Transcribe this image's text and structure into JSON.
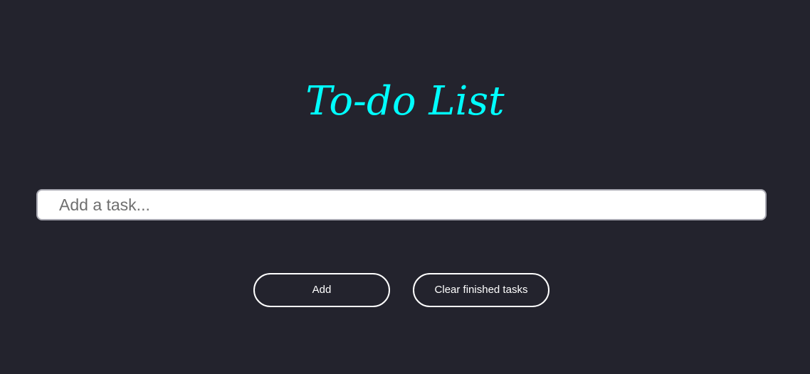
{
  "app": {
    "title": "To-do List",
    "title_color": "#00ffff",
    "background_color": "#23232d"
  },
  "task_input": {
    "value": "",
    "placeholder": "Add a task..."
  },
  "actions": {
    "add_label": "Add",
    "clear_label": "Clear finished tasks"
  }
}
